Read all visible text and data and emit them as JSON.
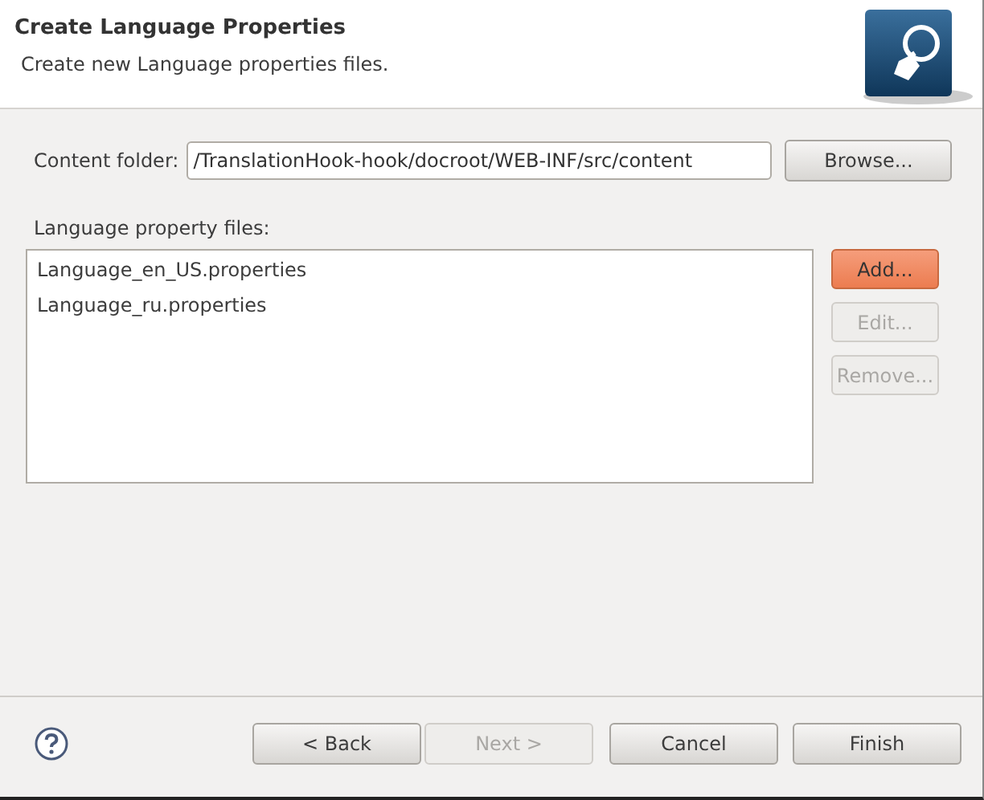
{
  "header": {
    "title": "Create Language Properties",
    "description": "Create new Language properties files."
  },
  "content_folder": {
    "label": "Content folder:",
    "value": "/TranslationHook-hook/docroot/WEB-INF/src/content",
    "button": "Browse..."
  },
  "files": {
    "label": "Language property files:",
    "items": [
      {
        "name": "Language_en_US.properties",
        "selected": false
      },
      {
        "name": "Language_ru.properties",
        "selected": false
      }
    ],
    "buttons": [
      {
        "label": "Add...",
        "highlighted": true,
        "disabled": false
      },
      {
        "label": "Edit...",
        "highlighted": false,
        "disabled": true
      },
      {
        "label": "Remove...",
        "highlighted": false,
        "disabled": true
      }
    ]
  },
  "footer": {
    "buttons": [
      {
        "label": "< Back",
        "disabled": false
      },
      {
        "label": "Next >",
        "disabled": true
      },
      {
        "label": "Cancel",
        "disabled": false
      },
      {
        "label": "Finish",
        "disabled": false
      }
    ]
  }
}
